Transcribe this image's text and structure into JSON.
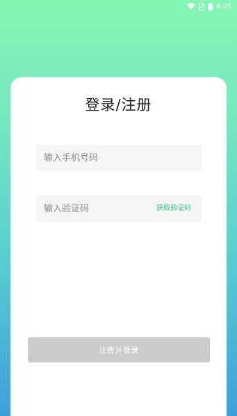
{
  "status_bar": {
    "time": "4:25",
    "icons": [
      "wifi-icon",
      "no-sim-icon",
      "battery-icon"
    ]
  },
  "login": {
    "title": "登录/注册",
    "phone_placeholder": "输入手机号码",
    "code_placeholder": "输入验证码",
    "get_code_label": "获取验证码",
    "submit_label": "注册并登录"
  },
  "colors": {
    "gradient_top": "#84f7b3",
    "gradient_bottom": "#3d9fda",
    "accent": "#34c28a",
    "button_disabled": "#cbcbcb",
    "field_bg": "#f5f5f5"
  }
}
